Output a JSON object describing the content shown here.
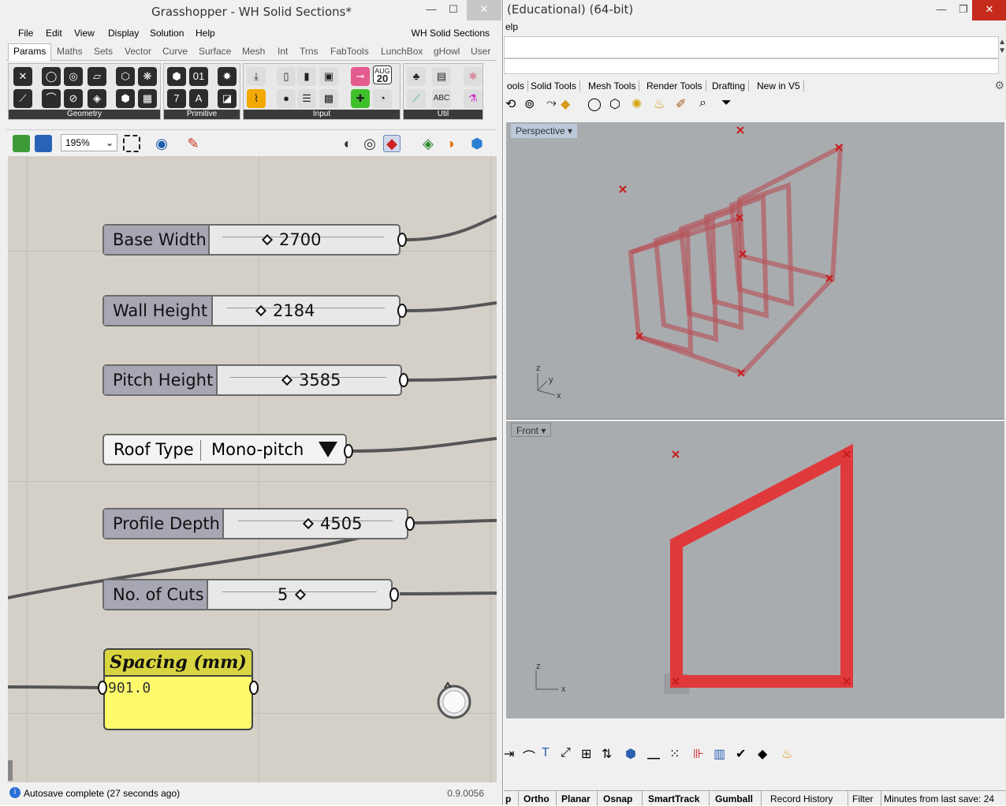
{
  "gh": {
    "title": "Grasshopper - WH Solid Sections*",
    "menu": [
      "File",
      "Edit",
      "View",
      "Display",
      "Solution",
      "Help"
    ],
    "doc_name": "WH Solid Sections",
    "tabs": [
      "Params",
      "Maths",
      "Sets",
      "Vector",
      "Curve",
      "Surface",
      "Mesh",
      "Int",
      "Trns",
      "FabTools",
      "LunchBox",
      "gHowl",
      "User"
    ],
    "ribbon_groups": [
      "Geometry",
      "Primitive",
      "Input",
      "Util"
    ],
    "calendar_icon": {
      "month": "AUG",
      "day": "20"
    },
    "zoom": "195%",
    "sliders": [
      {
        "name": "Base Width",
        "value": "2700"
      },
      {
        "name": "Wall Height",
        "value": "2184"
      },
      {
        "name": "Pitch Height",
        "value": "3585"
      },
      {
        "name": "Profile Depth",
        "value": "4505"
      },
      {
        "name": "No. of Cuts",
        "value": "5"
      }
    ],
    "value_list": {
      "name": "Roof Type",
      "selected": "Mono-pitch"
    },
    "panel": {
      "title": "Spacing (mm)",
      "value": "901.0"
    },
    "status": "Autosave complete (27 seconds ago)",
    "version": "0.9.0056",
    "colors": {
      "slider_name_bg": "#a7a7b3",
      "panel_bg": "#fdfa6b",
      "canvas_bg": "#d4d0c8"
    }
  },
  "rhino": {
    "title": "(Educational) (64-bit)",
    "menu_partial": "elp",
    "tabs": [
      "ools",
      "Solid Tools",
      "Mesh Tools",
      "Render Tools",
      "Drafting",
      "New in V5"
    ],
    "viewports": {
      "perspective": {
        "label": "Perspective",
        "axes": [
          "z",
          "y",
          "x"
        ]
      },
      "front": {
        "label": "Front",
        "axes": [
          "z",
          "x"
        ]
      }
    },
    "status_items": [
      "p",
      "Ortho",
      "Planar",
      "Osnap",
      "SmartTrack",
      "Gumball",
      "Record History",
      "Filter",
      "Minutes from last save: 24"
    ],
    "colors": {
      "geometry": "#e0393b",
      "viewport_bg": "#a9acaf"
    }
  }
}
